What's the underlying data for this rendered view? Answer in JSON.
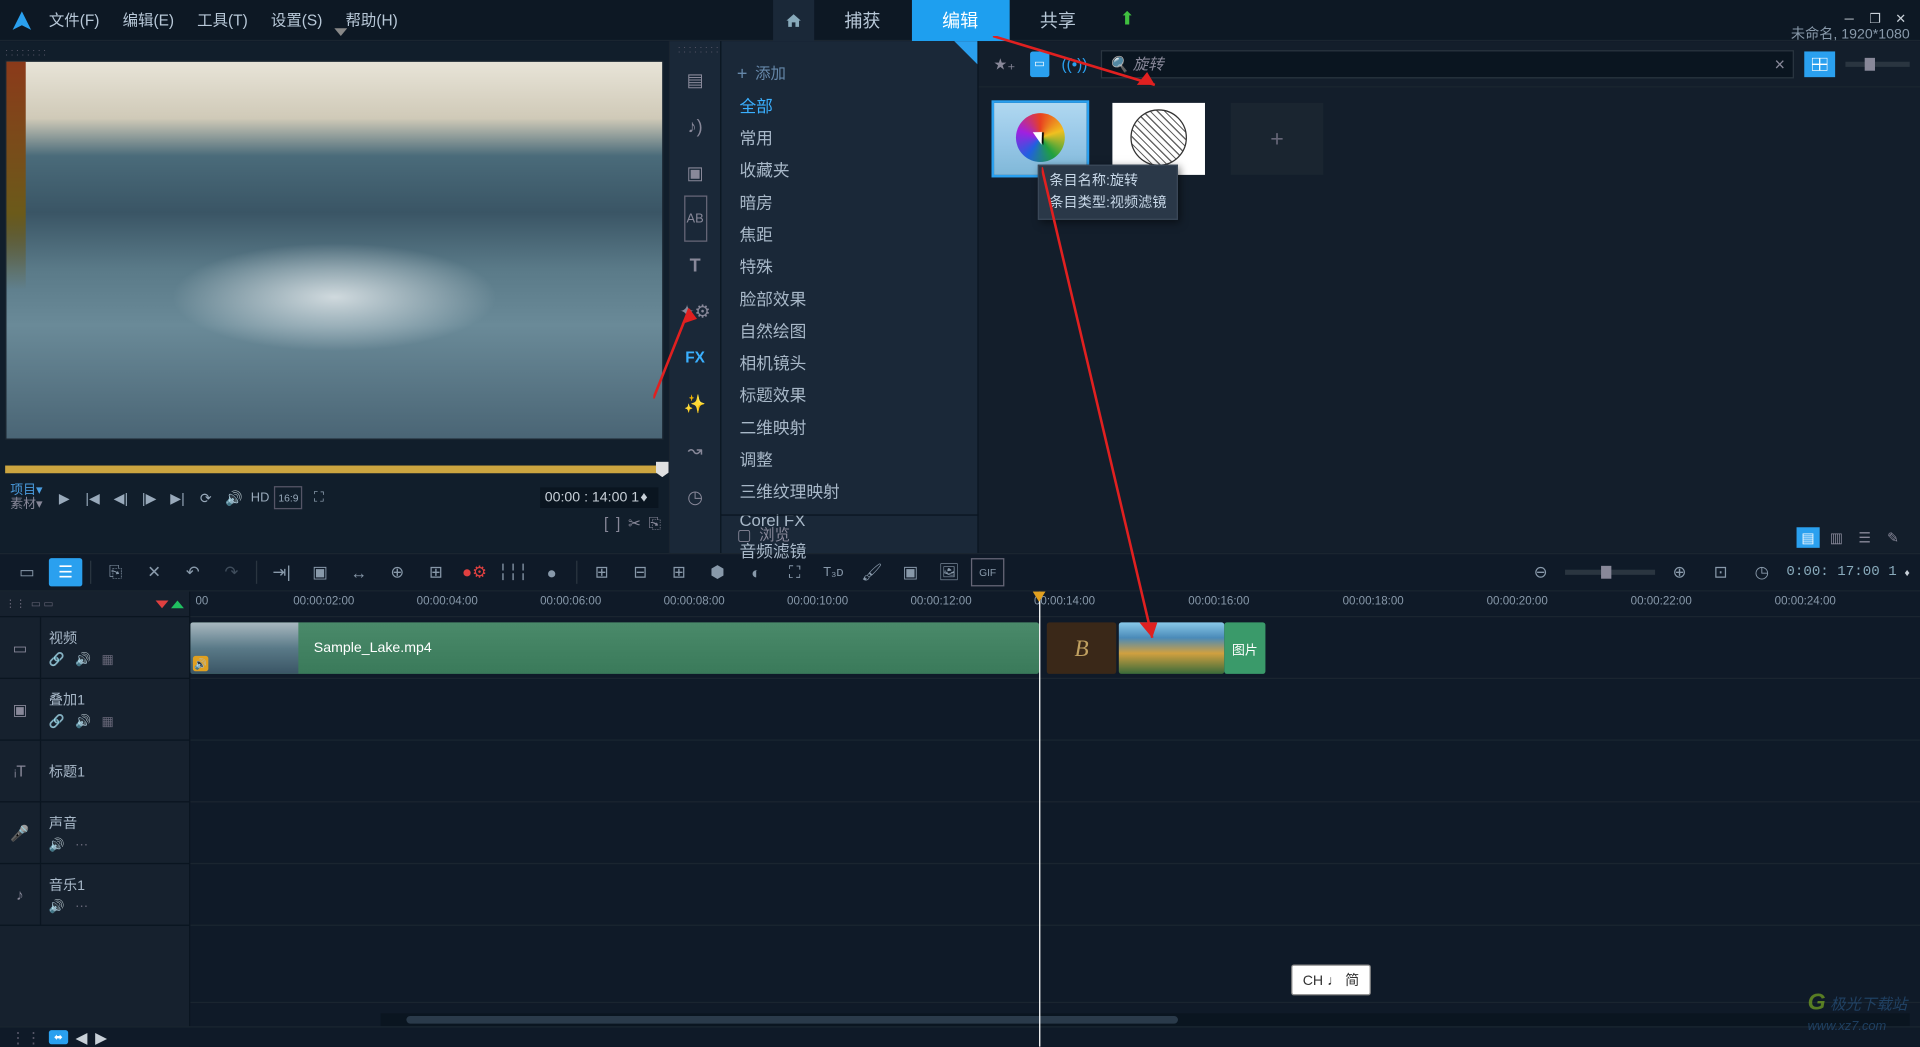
{
  "menu": {
    "file": "文件(F)",
    "edit": "编辑(E)",
    "tools": "工具(T)",
    "settings": "设置(S)",
    "help": "帮助(H)"
  },
  "tabs": {
    "capture": "捕获",
    "edit": "编辑",
    "share": "共享"
  },
  "project": {
    "name": "未命名",
    "resolution": "1920*1080"
  },
  "preview": {
    "mode_project": "项目",
    "mode_clip": "素材",
    "hd": "HD",
    "aspect": "16:9",
    "timecode": "00:00 : 14:00 1"
  },
  "lib": {
    "add": "添加",
    "browse": "浏览",
    "categories": [
      "全部",
      "常用",
      "收藏夹",
      "暗房",
      "焦距",
      "特殊",
      "脸部效果",
      "自然绘图",
      "相机镜头",
      "标题效果",
      "二维映射",
      "调整",
      "三维纹理映射",
      "Corel FX",
      "音频滤镜"
    ]
  },
  "search": {
    "placeholder": "旋转"
  },
  "tooltip": {
    "line1": "条目名称:旋转",
    "line2": "条目类型:视频滤镜"
  },
  "timeline": {
    "ticks": [
      "00",
      "00:00:02:00",
      "00:00:04:00",
      "00:00:06:00",
      "00:00:08:00",
      "00:00:10:00",
      "00:00:12:00",
      "00:00:14:00",
      "00:00:16:00",
      "00:00:18:00",
      "00:00:20:00",
      "00:00:22:00",
      "00:00:24:00"
    ],
    "tracks": {
      "video": "视频",
      "overlay": "叠加1",
      "title": "标题1",
      "voice": "声音",
      "music": "音乐1"
    },
    "clip_video": "Sample_Lake.mp4",
    "clip_img_label": "图片",
    "toolbar_tc": "0:00: 17:00 1"
  },
  "ime": "CH ♩ 简",
  "watermark": {
    "title": "极光下载站",
    "url": "www.xz7.com"
  }
}
